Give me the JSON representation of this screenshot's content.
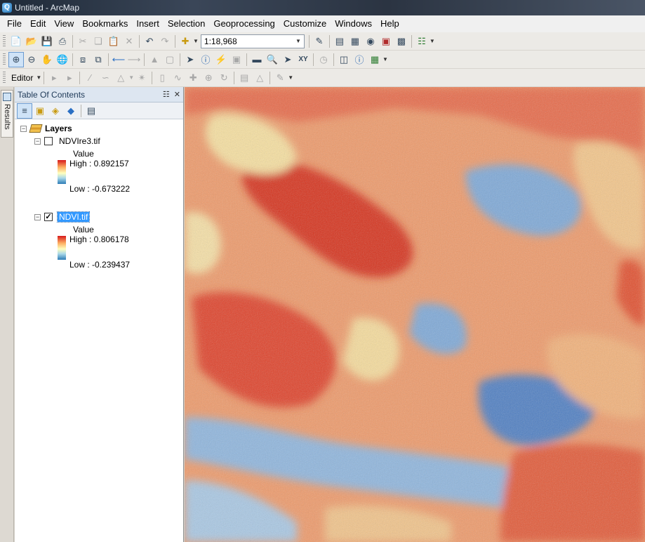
{
  "window": {
    "title": "Untitled - ArcMap",
    "icon": "arcmap-globe-icon"
  },
  "menu": [
    "File",
    "Edit",
    "View",
    "Bookmarks",
    "Insert",
    "Selection",
    "Geoprocessing",
    "Customize",
    "Windows",
    "Help"
  ],
  "standard_toolbar": {
    "scale": "1:18,968",
    "icons": [
      "new-document-icon",
      "open-folder-icon",
      "save-icon",
      "print-icon",
      "cut-icon",
      "copy-icon",
      "paste-icon",
      "delete-icon",
      "undo-icon",
      "redo-icon",
      "add-data-icon",
      "editor-toolbar-icon",
      "toc-window-icon",
      "catalog-window-icon",
      "search-window-icon",
      "arctoolbox-icon",
      "python-window-icon",
      "model-builder-icon"
    ]
  },
  "tools_toolbar": {
    "icons": [
      "zoom-in-icon",
      "zoom-out-icon",
      "pan-icon",
      "full-extent-icon",
      "fixed-zoom-in-icon",
      "fixed-zoom-out-icon",
      "back-extent-icon",
      "forward-extent-icon",
      "select-features-icon",
      "clear-selection-icon",
      "select-elements-icon",
      "identify-icon",
      "html-popup-icon",
      "measure-icon",
      "find-icon",
      "find-route-icon",
      "go-to-xy-icon",
      "time-slider-icon",
      "viewer-window-icon",
      "create-viewer-icon"
    ]
  },
  "editor_toolbar": {
    "label": "Editor"
  },
  "results_tab": {
    "label": "Results"
  },
  "toc": {
    "title": "Table Of Contents",
    "root_label": "Layers",
    "layers": [
      {
        "name": "NDVIre3.tif",
        "checked": false,
        "selected": false,
        "value_label": "Value",
        "high": "High : 0.892157",
        "low": "Low : -0.673222"
      },
      {
        "name": "NDVI.tif",
        "checked": true,
        "selected": true,
        "value_label": "Value",
        "high": "High : 0.806178",
        "low": "Low : -0.239437"
      }
    ]
  },
  "colors": {
    "ramp_high": "#d7191c",
    "ramp_mid": "#ffffbf",
    "ramp_low": "#2c7bb6",
    "selection": "#3399ff",
    "toc_header": "#dde6f1"
  }
}
